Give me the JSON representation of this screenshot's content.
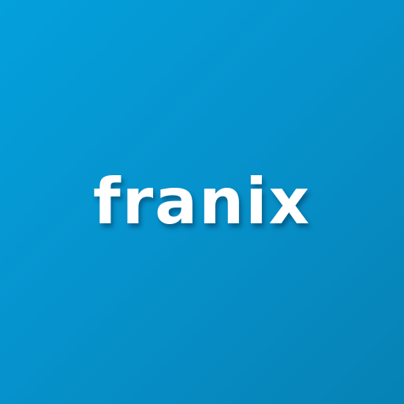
{
  "logo": {
    "text": "franix",
    "text_color": "#ffffff"
  },
  "background": {
    "gradient_start": "#03a0dc",
    "gradient_end": "#0682b5"
  }
}
